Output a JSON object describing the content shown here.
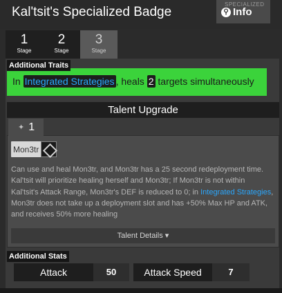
{
  "header": {
    "title": "Kal'tsit's Specialized Badge",
    "thumb_ghost_text": "SPECIALIZED",
    "info_label": "Info"
  },
  "stage_tabs": [
    {
      "num": "1",
      "label": "Stage"
    },
    {
      "num": "2",
      "label": "Stage"
    },
    {
      "num": "3",
      "label": "Stage"
    }
  ],
  "traits": {
    "label": "Additional Traits",
    "pre": "In",
    "mode": "Integrated Strategies",
    "mid": ", heals",
    "count": "2",
    "post": "targets simultaneously",
    "color": "#3bd33b"
  },
  "talent": {
    "header": "Talent Upgrade",
    "tab_num": "1",
    "tag": "Mon3tr",
    "desc_a": "Can use and heal Mon3tr, and Mon3tr has a 25 second redeployment time. Kal'tsit will prioritize healing herself and Mon3tr; If Mon3tr is not within Kal'tsit's Attack Range, Mon3tr's DEF is reduced to 0; in",
    "desc_link": "Integrated Strategies",
    "desc_b": ", Mon3tr does not take up a deployment slot and has +50% Max HP and ATK, and receives 50% more healing",
    "details_label": "Talent Details",
    "details_arrow": "▾"
  },
  "stats": {
    "label": "Additional Stats",
    "items": [
      {
        "name": "Attack",
        "value": "50"
      },
      {
        "name": "Attack Speed",
        "value": "7"
      }
    ]
  }
}
